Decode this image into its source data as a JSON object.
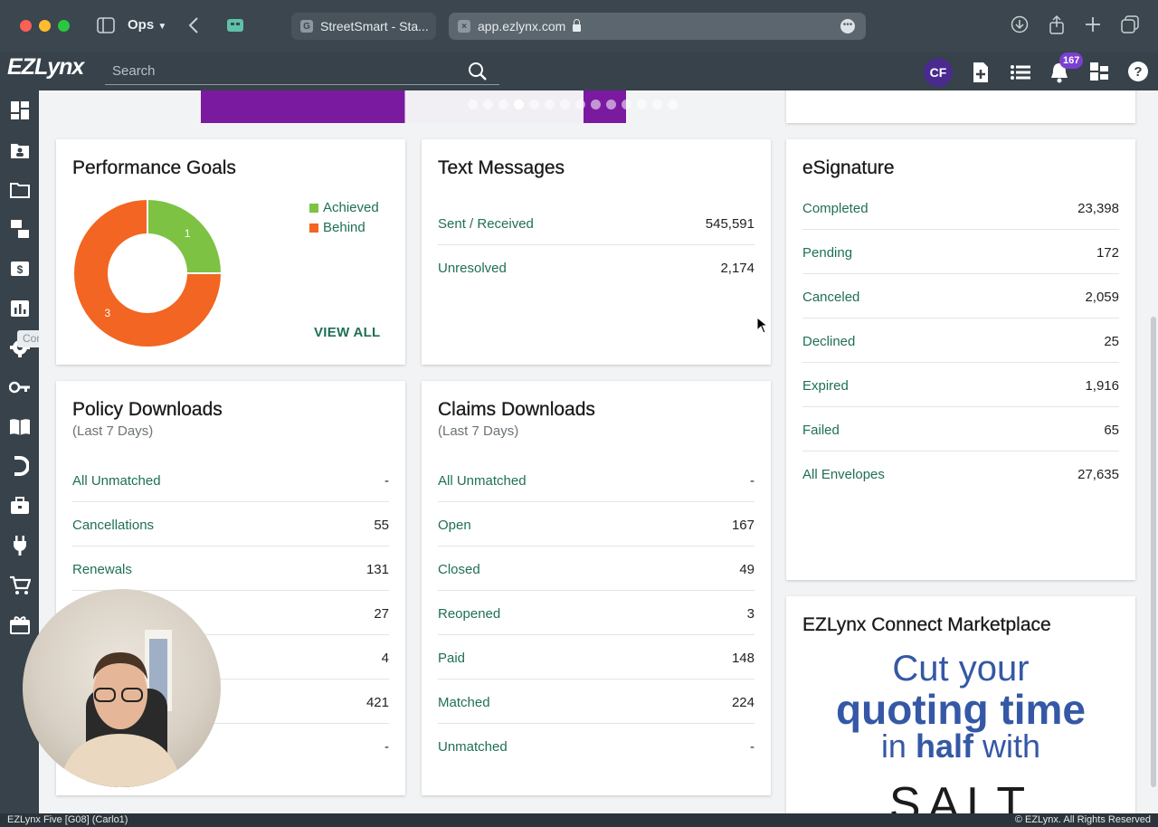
{
  "browser": {
    "profile": "Ops",
    "tabs": [
      {
        "label": "StreetSmart - Sta...",
        "favicon": "G"
      },
      {
        "label": "app.ezlynx.com",
        "favicon": "×"
      }
    ]
  },
  "header": {
    "logo": "EZLynx",
    "search_placeholder": "Search",
    "avatar": "CF",
    "notifications": "167"
  },
  "sidebar": {
    "tooltip": "Communication Center",
    "icons": [
      "dashboard-icon",
      "contacts-icon",
      "folder-icon",
      "communication-icon",
      "billing-icon",
      "reports-icon",
      "settings-icon",
      "key-icon",
      "book-icon",
      "magnet-icon",
      "briefcase-icon",
      "plug-icon",
      "cart-icon",
      "gift-icon"
    ]
  },
  "performance": {
    "title": "Performance Goals",
    "legend": [
      {
        "label": "Achieved",
        "color": "#7dc243"
      },
      {
        "label": "Behind",
        "color": "#f26522"
      }
    ],
    "view_all": "VIEW ALL",
    "chart_data": {
      "type": "pie",
      "categories": [
        "Achieved",
        "Behind"
      ],
      "values": [
        1,
        3
      ]
    }
  },
  "text_messages": {
    "title": "Text Messages",
    "rows": [
      {
        "label": "Sent / Received",
        "value": "545,591"
      },
      {
        "label": "Unresolved",
        "value": "2,174"
      }
    ]
  },
  "esignature": {
    "title": "eSignature",
    "rows": [
      {
        "label": "Completed",
        "value": "23,398"
      },
      {
        "label": "Pending",
        "value": "172"
      },
      {
        "label": "Canceled",
        "value": "2,059"
      },
      {
        "label": "Declined",
        "value": "25"
      },
      {
        "label": "Expired",
        "value": "1,916"
      },
      {
        "label": "Failed",
        "value": "65"
      },
      {
        "label": "All Envelopes",
        "value": "27,635"
      }
    ]
  },
  "policy": {
    "title": "Policy Downloads",
    "subtitle": "(Last 7 Days)",
    "rows": [
      {
        "label": "All Unmatched",
        "value": "-"
      },
      {
        "label": "Cancellations",
        "value": "55"
      },
      {
        "label": "Renewals",
        "value": "131"
      },
      {
        "label": "",
        "value": "27"
      },
      {
        "label": "",
        "value": "4"
      },
      {
        "label": "",
        "value": "421"
      },
      {
        "label": "",
        "value": "-"
      }
    ]
  },
  "claims": {
    "title": "Claims Downloads",
    "subtitle": "(Last 7 Days)",
    "rows": [
      {
        "label": "All Unmatched",
        "value": "-"
      },
      {
        "label": "Open",
        "value": "167"
      },
      {
        "label": "Closed",
        "value": "49"
      },
      {
        "label": "Reopened",
        "value": "3"
      },
      {
        "label": "Paid",
        "value": "148"
      },
      {
        "label": "Matched",
        "value": "224"
      },
      {
        "label": "Unmatched",
        "value": "-"
      }
    ]
  },
  "marketplace": {
    "title": "EZLynx Connect Marketplace",
    "ad_line1": "Cut your",
    "ad_line2": "quoting time",
    "ad_line3a": "in",
    "ad_line3b": "half",
    "ad_line3c": "with",
    "ad_line4": "SALT"
  },
  "status": {
    "left": "EZLynx Five [G08] (Carlo1)",
    "right": "© EZLynx. All Rights Reserved"
  }
}
